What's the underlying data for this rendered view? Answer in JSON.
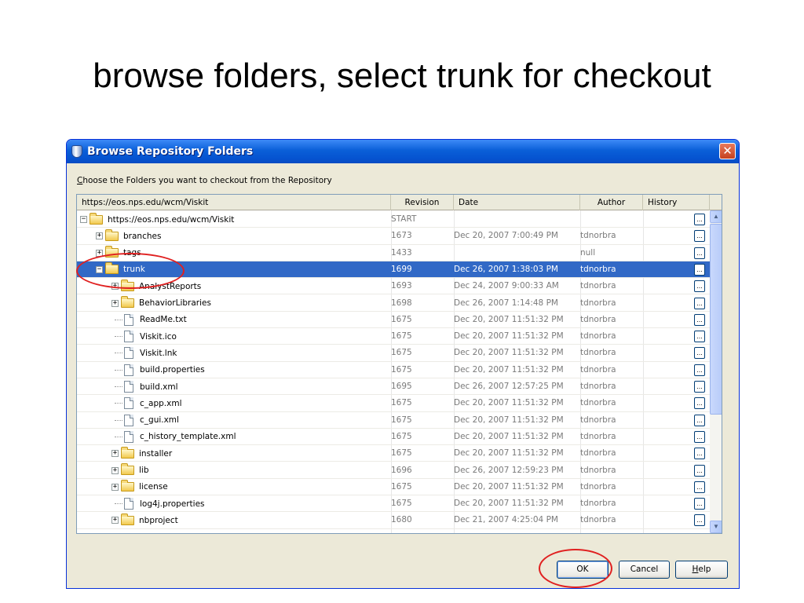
{
  "slide": {
    "title": "browse folders, select trunk for checkout"
  },
  "dialog": {
    "title": "Browse Repository Folders",
    "close_glyph": "✕",
    "instruction_mnemonic": "C",
    "instruction_rest": "hoose the Folders you want to checkout from the Repository",
    "columns": {
      "name": "https://eos.nps.edu/wcm/Viskit",
      "revision": "Revision",
      "date": "Date",
      "author": "Author",
      "history": "History"
    },
    "rows": [
      {
        "name": "https://eos.nps.edu/wcm/Viskit",
        "kind": "folder",
        "depth": 0,
        "expander": "−",
        "revision": "START",
        "date": "",
        "author": ""
      },
      {
        "name": "branches",
        "kind": "folder",
        "depth": 1,
        "expander": "+",
        "revision": "1673",
        "date": "Dec 20, 2007 7:00:49 PM",
        "author": "tdnorbra"
      },
      {
        "name": "tags",
        "kind": "folder",
        "depth": 1,
        "expander": "+",
        "revision": "1433",
        "date": "",
        "author": "null"
      },
      {
        "name": "trunk",
        "kind": "folder",
        "depth": 1,
        "expander": "−",
        "revision": "1699",
        "date": "Dec 26, 2007 1:38:03 PM",
        "author": "tdnorbra",
        "selected": true
      },
      {
        "name": "AnalystReports",
        "kind": "folder",
        "depth": 2,
        "expander": "+",
        "revision": "1693",
        "date": "Dec 24, 2007 9:00:33 AM",
        "author": "tdnorbra"
      },
      {
        "name": "BehaviorLibraries",
        "kind": "folder",
        "depth": 2,
        "expander": "+",
        "revision": "1698",
        "date": "Dec 26, 2007 1:14:48 PM",
        "author": "tdnorbra"
      },
      {
        "name": "ReadMe.txt",
        "kind": "file",
        "depth": 2,
        "revision": "1675",
        "date": "Dec 20, 2007 11:51:32 PM",
        "author": "tdnorbra"
      },
      {
        "name": "Viskit.ico",
        "kind": "file",
        "depth": 2,
        "revision": "1675",
        "date": "Dec 20, 2007 11:51:32 PM",
        "author": "tdnorbra"
      },
      {
        "name": "Viskit.lnk",
        "kind": "file",
        "depth": 2,
        "revision": "1675",
        "date": "Dec 20, 2007 11:51:32 PM",
        "author": "tdnorbra"
      },
      {
        "name": "build.properties",
        "kind": "file",
        "depth": 2,
        "revision": "1675",
        "date": "Dec 20, 2007 11:51:32 PM",
        "author": "tdnorbra"
      },
      {
        "name": "build.xml",
        "kind": "file",
        "depth": 2,
        "revision": "1695",
        "date": "Dec 26, 2007 12:57:25 PM",
        "author": "tdnorbra"
      },
      {
        "name": "c_app.xml",
        "kind": "file",
        "depth": 2,
        "revision": "1675",
        "date": "Dec 20, 2007 11:51:32 PM",
        "author": "tdnorbra"
      },
      {
        "name": "c_gui.xml",
        "kind": "file",
        "depth": 2,
        "revision": "1675",
        "date": "Dec 20, 2007 11:51:32 PM",
        "author": "tdnorbra"
      },
      {
        "name": "c_history_template.xml",
        "kind": "file",
        "depth": 2,
        "revision": "1675",
        "date": "Dec 20, 2007 11:51:32 PM",
        "author": "tdnorbra"
      },
      {
        "name": "installer",
        "kind": "folder",
        "depth": 2,
        "expander": "+",
        "revision": "1675",
        "date": "Dec 20, 2007 11:51:32 PM",
        "author": "tdnorbra"
      },
      {
        "name": "lib",
        "kind": "folder",
        "depth": 2,
        "expander": "+",
        "revision": "1696",
        "date": "Dec 26, 2007 12:59:23 PM",
        "author": "tdnorbra"
      },
      {
        "name": "license",
        "kind": "folder",
        "depth": 2,
        "expander": "+",
        "revision": "1675",
        "date": "Dec 20, 2007 11:51:32 PM",
        "author": "tdnorbra"
      },
      {
        "name": "log4j.properties",
        "kind": "file",
        "depth": 2,
        "revision": "1675",
        "date": "Dec 20, 2007 11:51:32 PM",
        "author": "tdnorbra"
      },
      {
        "name": "nbproject",
        "kind": "folder",
        "depth": 2,
        "expander": "+",
        "revision": "1680",
        "date": "Dec 21, 2007 4:25:04 PM",
        "author": "tdnorbra"
      }
    ],
    "history_button_label": "...",
    "scroll_up_glyph": "▲",
    "scroll_down_glyph": "▼",
    "buttons": {
      "ok": "OK",
      "cancel": "Cancel",
      "help_mnemonic": "H",
      "help_rest": "elp"
    }
  },
  "colors": {
    "titlebar": "#0553d0",
    "selection": "#3169c6",
    "annotation": "#e02020"
  }
}
